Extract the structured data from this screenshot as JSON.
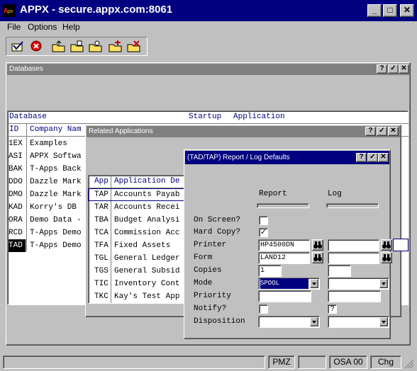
{
  "window": {
    "title": "APPX - secure.appx.com:8061",
    "controls": [
      "_",
      "□",
      "✕"
    ]
  },
  "menu": {
    "items": [
      "File",
      "Options",
      "Help"
    ]
  },
  "toolbar": {
    "buttons": [
      "check-mail-icon",
      "stop-icon",
      "folder-up-icon",
      "folder-open-icon",
      "folder-search-icon",
      "folder-new-icon",
      "folder-delete-icon"
    ]
  },
  "databases": {
    "title": "Databases",
    "headers": {
      "database": "Database",
      "startup": "Startup",
      "application": "Application",
      "id": "ID",
      "company": "Company Nam"
    },
    "rows": [
      {
        "id": "1EX",
        "name": "Examples"
      },
      {
        "id": "ASI",
        "name": "APPX Softwa"
      },
      {
        "id": "BAK",
        "name": "T-Apps Back"
      },
      {
        "id": "DDO",
        "name": "Dazzle Mark"
      },
      {
        "id": "DMO",
        "name": "Dazzle Mark"
      },
      {
        "id": "KAD",
        "name": "Korry's DB"
      },
      {
        "id": "ORA",
        "name": "Demo Data -"
      },
      {
        "id": "RCD",
        "name": "T-Apps Demo"
      },
      {
        "id": "TAD",
        "name": "T-Apps Demo"
      }
    ],
    "selected_id": "TAD"
  },
  "related": {
    "title": "Related Applications",
    "headers": {
      "app": "App",
      "desc": "Application De"
    },
    "rows": [
      {
        "app": "TAP",
        "name": "Accounts Payab"
      },
      {
        "app": "TAR",
        "name": "Accounts Recei"
      },
      {
        "app": "TBA",
        "name": "Budget Analysi"
      },
      {
        "app": "TCA",
        "name": "Commission Acc"
      },
      {
        "app": "TFA",
        "name": "Fixed Assets"
      },
      {
        "app": "TGL",
        "name": "General Ledger"
      },
      {
        "app": "TGS",
        "name": "General Subsid"
      },
      {
        "app": "TIC",
        "name": "Inventory Cont"
      },
      {
        "app": "TKC",
        "name": "Kay's Test App"
      }
    ]
  },
  "defaults": {
    "title": "(TAD/TAP) Report / Log Defaults",
    "col_report": "Report",
    "col_log": "Log",
    "labels": {
      "on_screen": "On Screen?",
      "hard_copy": "Hard Copy?",
      "printer": "Printer",
      "form": "Form",
      "copies": "Copies",
      "mode": "Mode",
      "priority": "Priority",
      "notify": "Notify?",
      "disposition": "Disposition"
    },
    "report": {
      "on_screen": "",
      "hard_copy": "✓",
      "printer": "HP4500DN",
      "form": "LAND12",
      "copies": "1",
      "mode": "SPOOL",
      "priority": "",
      "notify": "",
      "disposition": ""
    },
    "log": {
      "printer": "",
      "form": "",
      "copies": "",
      "mode": "",
      "priority": "",
      "notify": "?",
      "disposition": ""
    }
  },
  "status": {
    "s1": "PMZ",
    "s2": "OSA 00",
    "s3": "Chg"
  },
  "colors": {
    "title_active": "#000080",
    "title_inactive": "#808080",
    "header_text": "#000080"
  }
}
